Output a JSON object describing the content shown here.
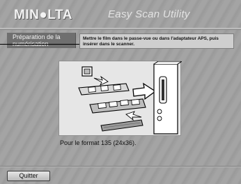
{
  "header": {
    "brand": "MIN●LTA",
    "app_title": "Easy Scan Utility"
  },
  "step": {
    "label": "Préparation de la numérisation"
  },
  "instruction": {
    "text": "Mettre le film dans le passe-vue ou dans l'adaptateur APS, puis insérer dans le scanner."
  },
  "illustration": {
    "caption": "Pour le format 135 (24x36)."
  },
  "footer": {
    "quit_label": "Quitter"
  },
  "colors": {
    "background": "#a0a0a0",
    "step_tab": "#6f6f6f",
    "instruction_box": "#cfcfcf",
    "illustration_panel": "#e6e6e6"
  }
}
